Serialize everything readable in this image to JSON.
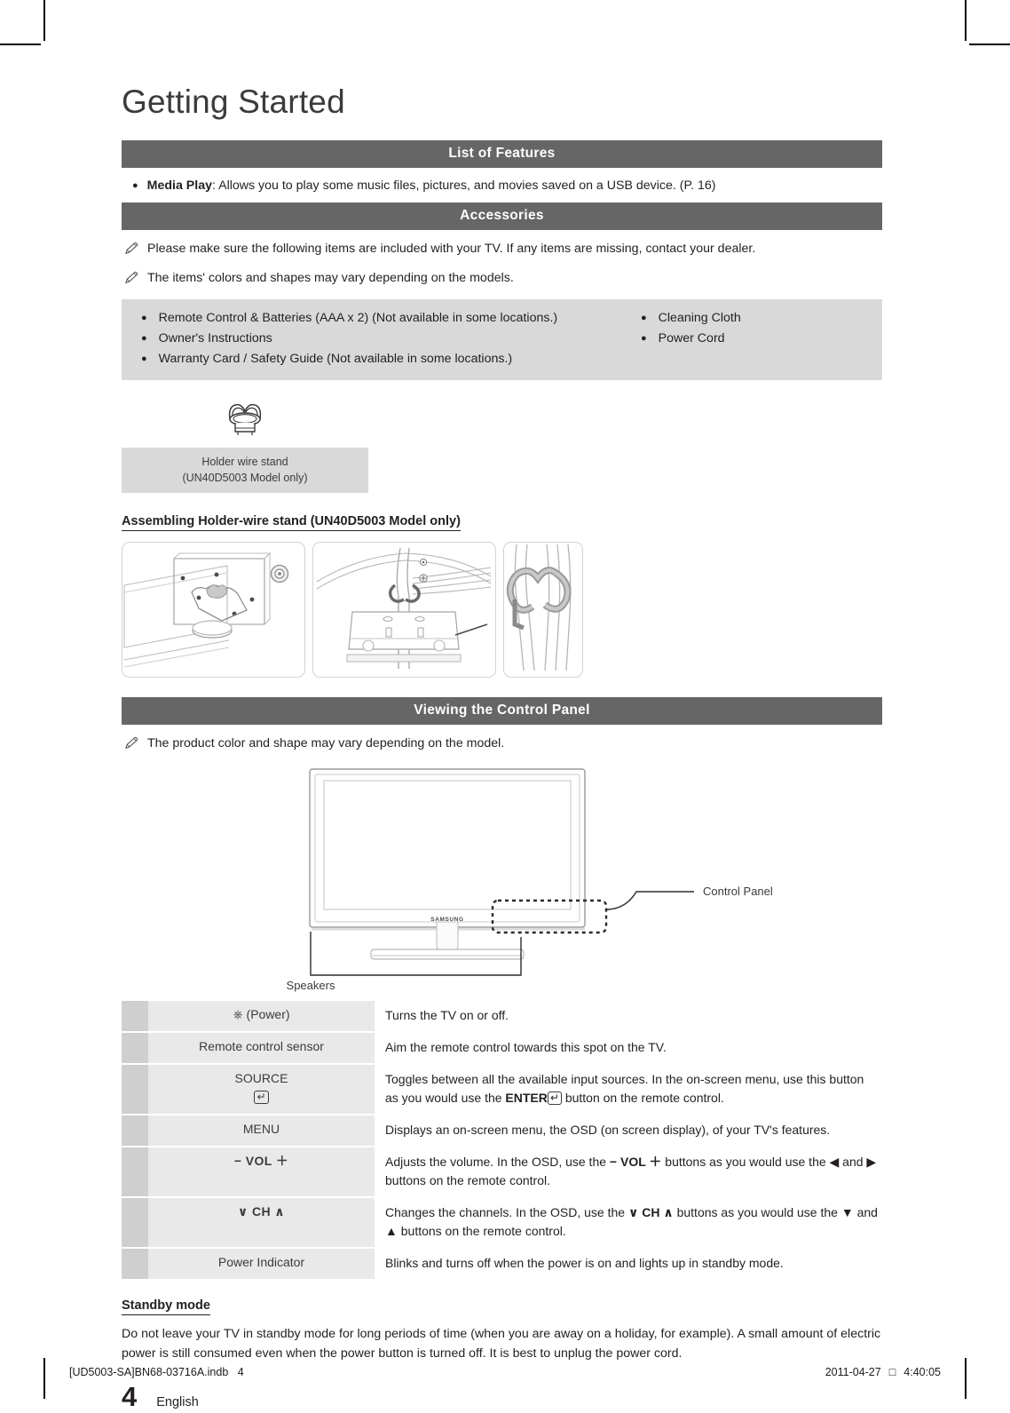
{
  "document": {
    "title": "Getting Started",
    "page_number": "4",
    "language": "English"
  },
  "sections": {
    "features": {
      "bar_label": "List of Features",
      "bullet_bold": "Media Play",
      "bullet_text": ": Allows you to play some music files, pictures, and movies saved on a USB device. (P. 16)"
    },
    "accessories": {
      "bar_label": "Accessories",
      "notes": [
        "Please make sure the following items are included with your TV. If any items are missing, contact your dealer.",
        "The items' colors and shapes may vary depending on the models."
      ],
      "items_left": [
        "Remote Control & Batteries (AAA x 2) (Not available in some locations.)",
        "Owner's Instructions",
        "Warranty Card / Safety Guide (Not available in some locations.)"
      ],
      "items_right": [
        "Cleaning Cloth",
        "Power Cord"
      ],
      "holder_caption_line1": "Holder wire stand",
      "holder_caption_line2": "(UN40D5003 Model only)"
    },
    "assembling": {
      "heading": "Assembling Holder-wire stand (UN40D5003 Model only)"
    },
    "control_panel": {
      "bar_label": "Viewing the Control Panel",
      "note": "The product color and shape may vary depending on the model.",
      "diagram_labels": {
        "control_panel": "Control Panel",
        "speakers": "Speakers",
        "brand": "SAMSUNG"
      },
      "rows": [
        {
          "label": "(Power)",
          "icon": "power-icon",
          "description": "Turns the TV on or off."
        },
        {
          "label": "Remote control sensor",
          "description": "Aim the remote control towards this spot on the TV."
        },
        {
          "label": "SOURCE",
          "icon": "enter-key-icon",
          "description_part1": "Toggles between all the available input sources. In the on-screen menu, use this button as you would use the ",
          "description_enter": "ENTER",
          "description_part2": " button on the remote control."
        },
        {
          "label": "MENU",
          "description": "Displays an on-screen menu, the OSD (on screen display), of your TV's features."
        },
        {
          "label": "− VOL ＋",
          "description_part1": "Adjusts the volume. In the OSD, use the ",
          "description_key": "− VOL ＋",
          "description_part2": " buttons as you would use the ◀ and ▶ buttons on the remote control."
        },
        {
          "label": "∨ CH ∧",
          "description_part1": "Changes the channels. In the OSD, use the ",
          "description_key": "∨ CH ∧",
          "description_part2": " buttons as you would use the ▼ and ▲ buttons on the remote control."
        },
        {
          "label": "Power Indicator",
          "description": "Blinks and turns off when the power is on and lights up in standby mode."
        }
      ]
    },
    "standby": {
      "heading": "Standby mode",
      "body": "Do not leave your TV in standby mode for long periods of time (when you are away on a holiday, for example). A small amount of electric power is still consumed even when the power button is turned off. It is best to unplug the power cord."
    }
  },
  "footer": {
    "file": "[UD5003-SA]BN68-03716A.indb",
    "file_page": "4",
    "date": "2011-04-27",
    "ampm": "□",
    "time": "4:40:05"
  },
  "colors": {
    "bar": "#666666",
    "accessory_box": "#d9d9d9",
    "table_label": "#e9e9e9",
    "table_marker": "#cfcfcf"
  }
}
